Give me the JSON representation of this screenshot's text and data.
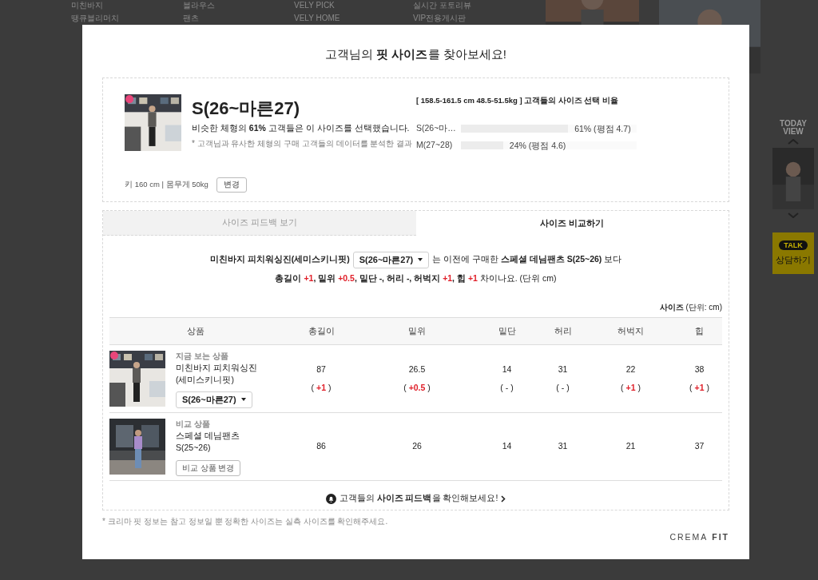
{
  "background": {
    "link_columns": [
      [
        "미친바지",
        "땡큐블리머치"
      ],
      [
        "블라우스",
        "팬츠"
      ],
      [
        "VELY PICK",
        "VELY HOME"
      ],
      [
        "실시간 포토리뷰",
        "VIP전용게시판"
      ]
    ],
    "today_view": {
      "title": "TODAY VIEW"
    },
    "talk": {
      "badge": "TALK",
      "label": "상담하기"
    }
  },
  "modal": {
    "title": "고객님의 **핏 사이즈**를 찾아보세요!",
    "summary": {
      "size": "S(26~마른27)",
      "sentence": "비슷한 체형의 **61%** 고객들은 이 사이즈를 선택했습니다.",
      "note": "* 고객님과 유사한 체형의 구매 고객들의 데이터를 분석한 결과",
      "body": "키 160 cm | 몸무게 50kg",
      "change_button": "변경",
      "ratio_title": "[ 158.5-161.5 cm 48.5-51.5kg ] 고객들의 사이즈 선택 비율",
      "ratios": [
        {
          "label": "S(26~마…",
          "level": 0.61,
          "reading": "61% (평점 4.7)"
        },
        {
          "label": "M(27~28)",
          "level": 0.24,
          "reading": "24% (평점 4.6)"
        }
      ]
    },
    "tabs": [
      {
        "label": "사이즈 피드백 보기",
        "selected": false
      },
      {
        "label": "사이즈 비교하기",
        "selected": true
      }
    ],
    "compare": {
      "product": "미친바지 피치워싱진(세미스키니핏)",
      "size_select": "S(26~마른27)",
      "rest": "는 이전에 구매한 **스페셜 데님팬츠 S(25~26)** 보다",
      "diff_line": [
        {
          "text": "총길이 ",
          "kind": "bold"
        },
        {
          "text": "+1",
          "kind": "diff"
        },
        {
          "text": ", 밑위 ",
          "kind": "bold"
        },
        {
          "text": "+0.5",
          "kind": "diff"
        },
        {
          "text": ", 밑단 -, 허리 -, 허벅지 ",
          "kind": "bold"
        },
        {
          "text": "+1",
          "kind": "diff"
        },
        {
          "text": ", 힙 ",
          "kind": "bold"
        },
        {
          "text": "+1",
          "kind": "diff"
        },
        {
          "text": " 차이나요. (단위 cm)",
          "kind": "plain"
        }
      ],
      "unit": "**사이즈** (단위: cm)",
      "columns": [
        "상품",
        "총길이",
        "밑위",
        "밑단",
        "허리",
        "허벅지",
        "힙"
      ],
      "rows": [
        {
          "kind": "current",
          "tag": "지금 보는 상품",
          "name": "미친바지 피치워싱진(세미스키니핏)",
          "size_select": "S(26~마른27)",
          "values": [
            {
              "value": "87",
              "diff": [
                "(",
                "+1",
                ")"
              ],
              "changed": true
            },
            {
              "value": "26.5",
              "diff": [
                "(",
                "+0.5",
                ")"
              ],
              "changed": true
            },
            {
              "value": "14",
              "diff": [
                "(",
                "-",
                ")"
              ],
              "changed": false
            },
            {
              "value": "31",
              "diff": [
                "(",
                "-",
                ")"
              ],
              "changed": false
            },
            {
              "value": "22",
              "diff": [
                "(",
                "+1",
                ")"
              ],
              "changed": true
            },
            {
              "value": "38",
              "diff": [
                "(",
                "+1",
                ")"
              ],
              "changed": true
            }
          ]
        },
        {
          "kind": "compare",
          "tag": "비교 상품",
          "name": "스페셜 데님팬츠",
          "size": "S(25~26)",
          "button": "비교 상품 변경",
          "values": [
            {
              "value": "86"
            },
            {
              "value": "26"
            },
            {
              "value": "14"
            },
            {
              "value": "31"
            },
            {
              "value": "21"
            },
            {
              "value": "37"
            }
          ]
        }
      ],
      "feedback_link": "고객들의 **사이즈 피드백**을 확인해보세요!"
    },
    "footer_note": "* 크리마 핏 정보는 참고 정보일 뿐 정확한 사이즈는 실측 사이즈를 확인해주세요.",
    "brand": [
      "CREMA",
      "FIT"
    ]
  }
}
